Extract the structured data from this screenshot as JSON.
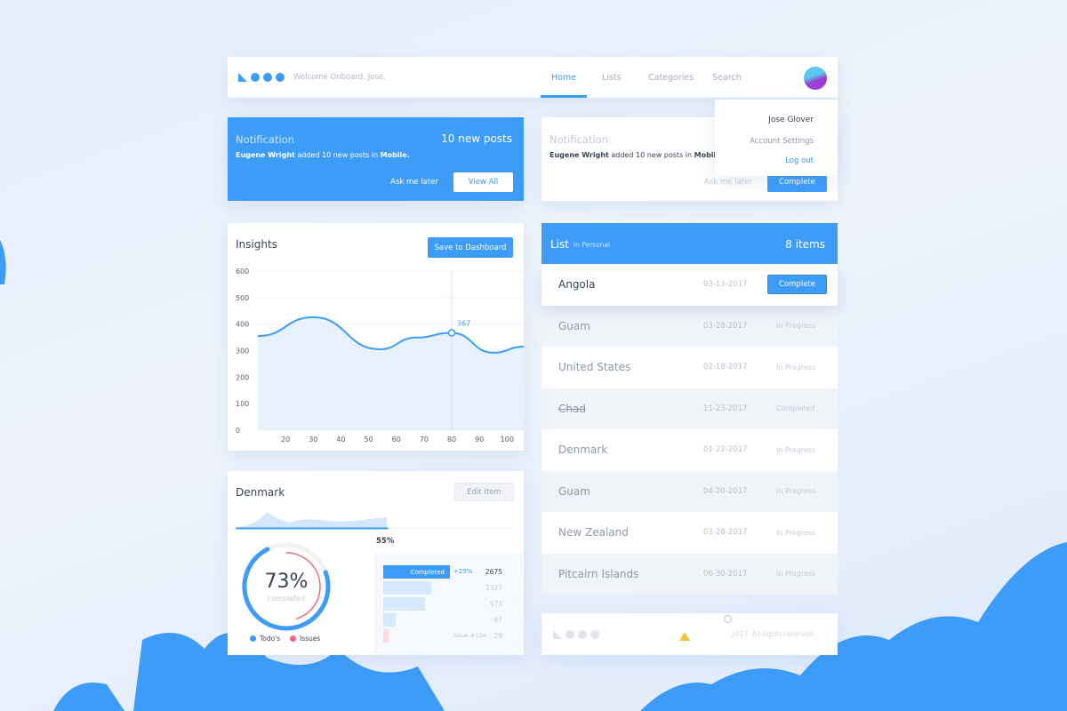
{
  "header": {
    "welcome": "Welcome Onboard,  Jose.",
    "nav": [
      "Home",
      "Lists",
      "Categories",
      "Search"
    ],
    "active": "Home"
  },
  "user_menu": {
    "name": "Jose Glover",
    "settings": "Account Settings",
    "logout": "Log out"
  },
  "notification_primary": {
    "title": "Notification",
    "count": "10 new posts",
    "author": "Eugene Wright",
    "text": " added 10 new posts in ",
    "target": "Mobile.",
    "later": "Ask me later",
    "action": "View All"
  },
  "notification_secondary": {
    "title": "Notification",
    "author": "Eugene Wright",
    "text": " added 10 new posts in ",
    "target": "Mobile.",
    "later": "Ask me later",
    "action": "Complete"
  },
  "insights": {
    "title": "Insights",
    "button": "Save to Dashboard",
    "highlight_label": "367",
    "chart_data": {
      "type": "area",
      "x": [
        10,
        30,
        54,
        67,
        80,
        95,
        106
      ],
      "y": [
        355,
        426,
        305,
        349,
        367,
        292,
        315
      ],
      "xticks": [
        20,
        30,
        40,
        50,
        60,
        70,
        80,
        90,
        100
      ],
      "yticks": [
        0,
        100,
        200,
        300,
        400,
        500,
        600
      ],
      "ylim": [
        0,
        600
      ],
      "xlim": [
        10,
        106
      ],
      "grid": true,
      "highlight": {
        "x": 80,
        "y": 367
      },
      "color": "#3d9cf8"
    }
  },
  "denmark": {
    "title": "Denmark",
    "button": "Edit Item",
    "progress_pct": "55%",
    "progress": 0.55,
    "ring_value": "73%",
    "ring_fraction": 0.73,
    "ring_label": "completed",
    "legend": [
      "Todo's",
      "Issues"
    ],
    "bars": [
      {
        "label": "Completed",
        "delta": "+25%",
        "value": "2675",
        "fraction": 1
      },
      {
        "value": "1327",
        "fraction": 0.72
      },
      {
        "value": "573",
        "fraction": 0.63
      },
      {
        "value": "67",
        "fraction": 0.18
      },
      {
        "label": "Issue #134",
        "value": "29",
        "fraction": 0.07
      }
    ]
  },
  "list": {
    "title": "List",
    "subtitle": "in Personal",
    "count": "8 items",
    "items": [
      {
        "name": "Angola",
        "date": "03-13-2017",
        "status": "Complete"
      },
      {
        "name": "Guam",
        "date": "03-28-2017",
        "status": "In Progress"
      },
      {
        "name": "United States",
        "date": "02-18-2017",
        "status": "In Progress"
      },
      {
        "name": "Chad",
        "date": "11-23-2017",
        "status": "Completed"
      },
      {
        "name": "Denmark",
        "date": "01-22-2017",
        "status": "In Progress"
      },
      {
        "name": "Guam",
        "date": "04-20-2017",
        "status": "In Progress"
      },
      {
        "name": "New Zealand",
        "date": "03-28-2017",
        "status": "In Progress"
      },
      {
        "name": "Pitcairn Islands",
        "date": "06-30-2017",
        "status": "In Progress"
      }
    ]
  },
  "footer": {
    "copyright": "2017. All rights reserved."
  },
  "colors": {
    "accent": "#3d9cf8",
    "issues": "#f0677f"
  }
}
